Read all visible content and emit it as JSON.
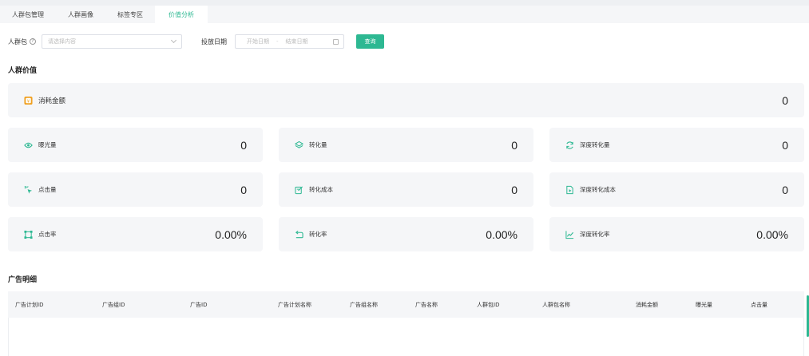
{
  "tabs": [
    {
      "label": "人群包管理"
    },
    {
      "label": "人群画像"
    },
    {
      "label": "标签专区"
    },
    {
      "label": "价值分析"
    }
  ],
  "filter": {
    "package_label": "人群包",
    "package_placeholder": "请选择内容",
    "date_label": "投放日期",
    "start_placeholder": "开始日期",
    "range_sep": "-",
    "end_placeholder": "结束日期",
    "query_label": "查询"
  },
  "value_section": {
    "title": "人群价值"
  },
  "total": {
    "label": "消耗金额",
    "value": "0",
    "icon": "coin-icon"
  },
  "metrics": [
    {
      "label": "曝光量",
      "value": "0",
      "icon": "eye-icon"
    },
    {
      "label": "转化量",
      "value": "0",
      "icon": "layers-icon"
    },
    {
      "label": "深度转化量",
      "value": "0",
      "icon": "refresh-icon"
    },
    {
      "label": "点击量",
      "value": "0",
      "icon": "click-icon"
    },
    {
      "label": "转化成本",
      "value": "0",
      "icon": "edit-icon"
    },
    {
      "label": "深度转化成本",
      "value": "0",
      "icon": "doc-icon"
    },
    {
      "label": "点击率",
      "value": "0.00%",
      "icon": "crop-icon"
    },
    {
      "label": "转化率",
      "value": "0.00%",
      "icon": "return-icon"
    },
    {
      "label": "深度转化率",
      "value": "0.00%",
      "icon": "trend-icon"
    }
  ],
  "detail_section": {
    "title": "广告明细"
  },
  "table": {
    "columns": [
      "广告计划ID",
      "广告组ID",
      "广告ID",
      "广告计划名称",
      "广告组名称",
      "广告名称",
      "人群包ID",
      "人群包名称",
      "消耗金额",
      "曝光量",
      "点击量"
    ]
  },
  "colors": {
    "accent": "#2db892",
    "total_icon": "#f0a020"
  }
}
